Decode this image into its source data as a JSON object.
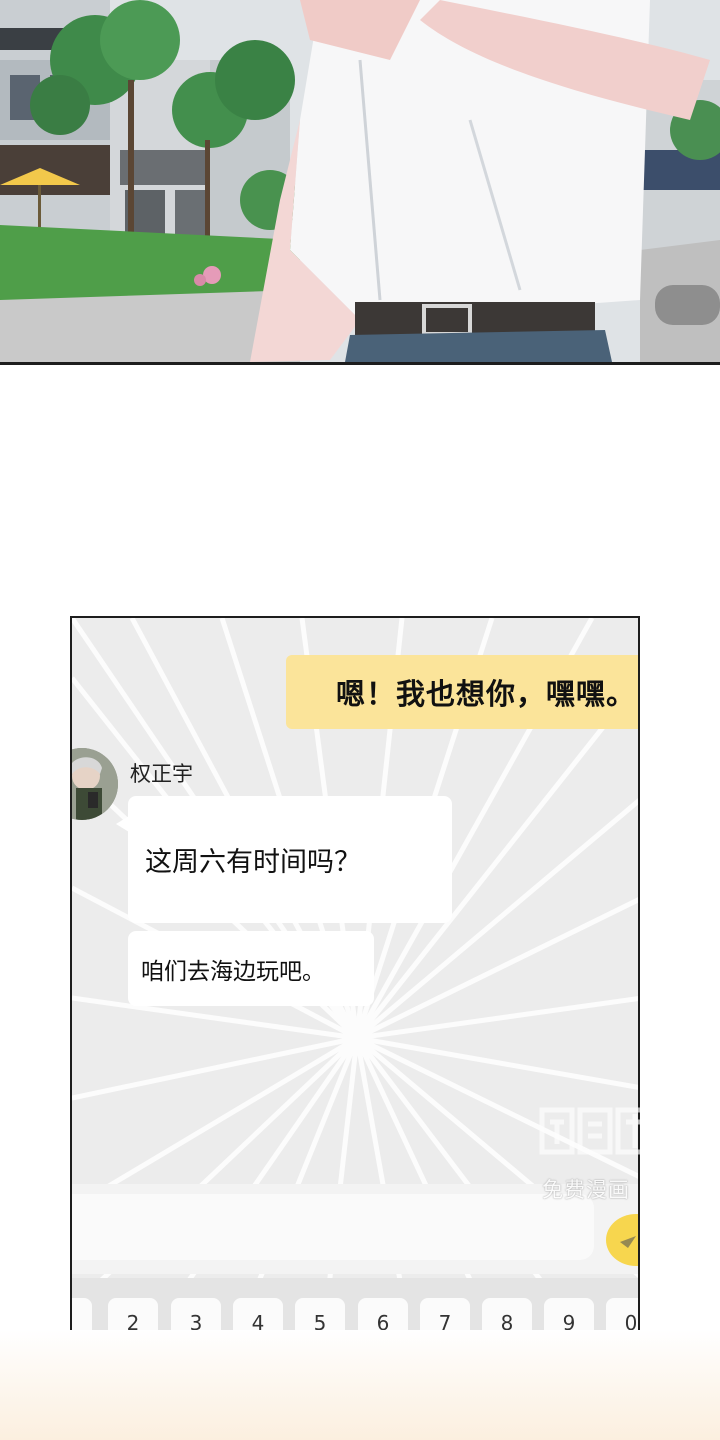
{
  "chat": {
    "sent_message": "嗯！我也想你，嘿嘿。",
    "sender_name": "权正宇",
    "messages": [
      "这周六有时间吗？",
      "咱们去海边玩吧。"
    ]
  },
  "keyboard": {
    "keys": [
      "2",
      "3",
      "4",
      "5",
      "6",
      "7",
      "8",
      "9",
      "0"
    ]
  },
  "watermark": {
    "text": "免费漫画"
  },
  "colors": {
    "sent_bubble": "#fbe49a",
    "received_bubble": "#ffffff",
    "chat_background": "#ececec",
    "send_button": "#f7d64e"
  }
}
